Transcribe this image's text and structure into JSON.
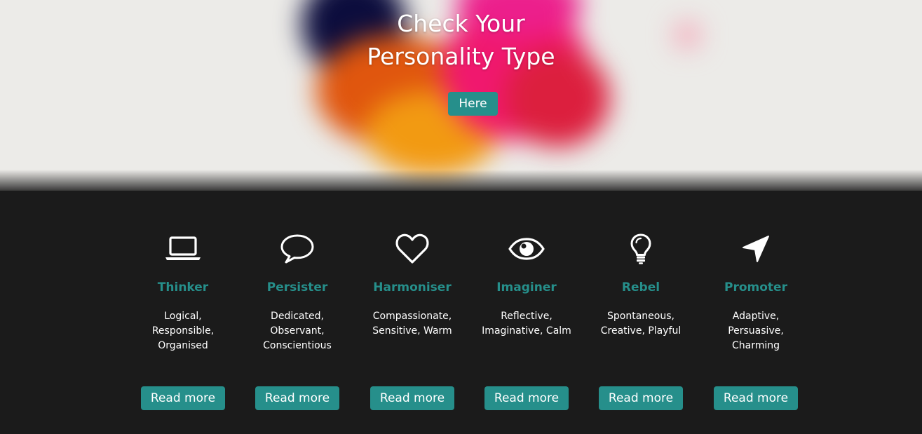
{
  "hero": {
    "title_line1": "Check Your",
    "title_line2": "Personality Type",
    "button_label": "Here"
  },
  "colors": {
    "accent": "#268f8b",
    "background": "#1b1b1b",
    "text": "#ffffff"
  },
  "types": [
    {
      "name": "Thinker",
      "icon": "laptop-icon",
      "traits": "Logical, Responsible, Organised",
      "button_label": "Read more"
    },
    {
      "name": "Persister",
      "icon": "speech-bubble-icon",
      "traits": "Dedicated, Observant, Conscientious",
      "button_label": "Read more"
    },
    {
      "name": "Harmoniser",
      "icon": "heart-icon",
      "traits": "Compassionate, Sensitive, Warm",
      "button_label": "Read more"
    },
    {
      "name": "Imaginer",
      "icon": "eye-icon",
      "traits": "Reflective, Imaginative, Calm",
      "button_label": "Read more"
    },
    {
      "name": "Rebel",
      "icon": "lightbulb-icon",
      "traits": "Spontaneous, Creative, Playful",
      "button_label": "Read more"
    },
    {
      "name": "Promoter",
      "icon": "location-arrow-icon",
      "traits": "Adaptive, Persuasive, Charming",
      "button_label": "Read more"
    }
  ]
}
